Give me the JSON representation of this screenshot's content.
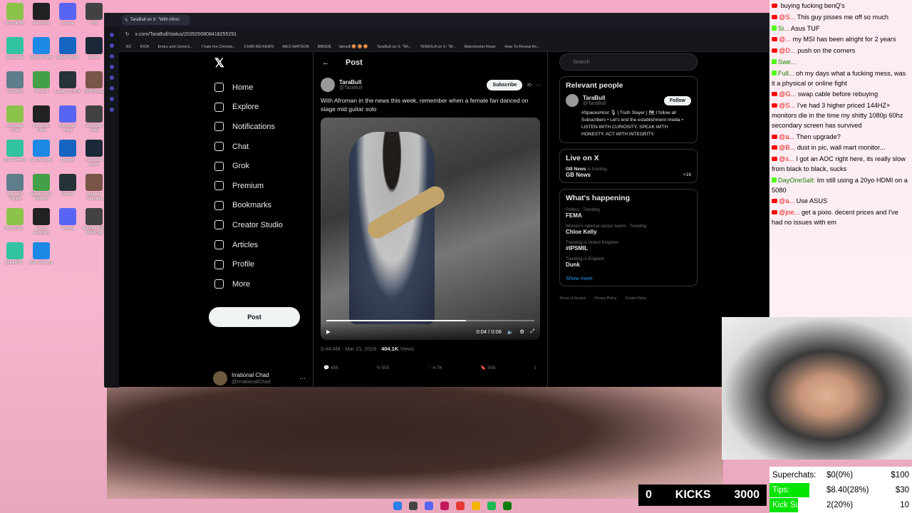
{
  "browser": {
    "tab_title": "TaraBull on X: \"With Afron",
    "url": "x.com/TaraBull/status/2035200808418255291",
    "bookmarks": [
      "BC",
      "KICK",
      "Emiru and Cinna's...",
      "I hate the Christia...",
      "CHIBI REVIEWS",
      "WES WATSON",
      "BBNO$",
      "bbno$ 🍪 🍪 🍪",
      "TaraBull on X: \"Wi...",
      "TENIOLA on X: \"M...",
      "Manchester Rose:",
      "How To Reveal An..."
    ]
  },
  "nav": {
    "items": [
      "Home",
      "Explore",
      "Notifications",
      "Chat",
      "Grok",
      "Premium",
      "Bookmarks",
      "Creator Studio",
      "Articles",
      "Profile",
      "More"
    ],
    "post_button": "Post",
    "account_name": "Irrational Chad",
    "account_handle": "@IrrationalChad"
  },
  "post": {
    "header": "Post",
    "author_name": "TaraBull",
    "author_handle": "@TaraBull",
    "subscribe": "Subscribe",
    "text": "With Afroman in the news this week, remember when a female fan danced on stage mid guitar solo",
    "video_time": "0:04 / 0:06",
    "video_progress": 0.67,
    "timestamp": "3:44 AM · Mar 21, 2026 ·",
    "views_count": "404.1K",
    "views_label": "Views",
    "replies": "456",
    "reposts": "505",
    "likes": "4.7K",
    "bookmarks": "558"
  },
  "sidebar": {
    "search_placeholder": "Search",
    "relevant_title": "Relevant people",
    "person_name": "TaraBull",
    "person_handle": "@TaraBull",
    "follow": "Follow",
    "bio": "#SpacesHost 🎙 | Truth Slayer | 🗺 I follow all Subscribers • Let's end the establishment media • LISTEN WITH CURIOSITY. SPEAK WITH HONESTY. ACT WITH INTEGRITY.",
    "live_title": "Live on X",
    "live_host": "GB News",
    "live_host_suffix": "is hosting",
    "live_name": "GB News",
    "live_count": "+16",
    "happening_title": "What's happening",
    "trends": [
      {
        "cat": "Politics · Trending",
        "name": "FEMA"
      },
      {
        "cat": "Women's national soccer teams · Trending",
        "name": "Chloe Kelly"
      },
      {
        "cat": "Trending in United Kingdom",
        "name": "#IPSMIL"
      },
      {
        "cat": "Trending in England",
        "name": "Dunk"
      }
    ],
    "show_more": "Show more",
    "footer": [
      "Terms of Service",
      "Privacy Policy",
      "Cookie Policy"
    ]
  },
  "chat": {
    "messages": [
      {
        "platform": "yt",
        "user": "",
        "text": "buying fucking benQ's"
      },
      {
        "platform": "yt",
        "user": "@S...",
        "text": "This guy pisses me off so much"
      },
      {
        "platform": "kick",
        "user": "Si...",
        "text": "Asus TUF"
      },
      {
        "platform": "yt",
        "user": "@...",
        "text": "my MSI has been alright for 2 years"
      },
      {
        "platform": "yt",
        "user": "@D...",
        "text": "push on the corners"
      },
      {
        "platform": "kick",
        "user": "Swe...",
        "text": ""
      },
      {
        "platform": "kick",
        "user": "Full...",
        "text": "oh my days what a fucking mess, was it a physical or online fight"
      },
      {
        "platform": "yt",
        "user": "@G...",
        "text": "swap cable before rebuying"
      },
      {
        "platform": "yt",
        "user": "@S...",
        "text": "I've had 3 higher priced 144HZ+ monitors die in the time my shitty 1080p 60hz secondary screen has survived"
      },
      {
        "platform": "yt",
        "user": "@a...",
        "text": "Then upgrade?"
      },
      {
        "platform": "yt",
        "user": "@B...",
        "text": "dust in pic, wall mart monitor..."
      },
      {
        "platform": "yt",
        "user": "@s...",
        "text": "I got an AOC right here, its really slow from black to black, sucks"
      },
      {
        "platform": "kick",
        "user": "DayOneSalt:",
        "text": "Im still using a 20yo HDMI on a 5080"
      },
      {
        "platform": "yt",
        "user": "@a...",
        "text": "Use ASUS"
      },
      {
        "platform": "yt",
        "user": "@joe...",
        "text": "get a pixio. decent prices and I've had no issues with em"
      }
    ]
  },
  "stats": {
    "superchats_label": "Superchats:",
    "superchats_value": "$0(0%)",
    "superchats_goal": "$100",
    "tips_label": "Tips:",
    "tips_value": "$8.40(28%)",
    "tips_goal": "$30",
    "tips_progress": 0.28,
    "kicksubs_label": "Kick Subs:",
    "kicksubs_value": "2(20%)",
    "kicksubs_goal": "10",
    "kicksubs_progress": 0.2
  },
  "kicks": {
    "current": "0",
    "label": "KICKS",
    "goal": "3000"
  },
  "desktop_icons": {
    "left": [
      "Recycle Bin",
      "obs-studio",
      "Discord",
      "OBS",
      "Streamlabs",
      "Roblox Player",
      "Roblox Studio",
      "Steam",
      "FAXSAVE",
      "Fallout 4",
      "Logitech G HUB",
      "EMOTE.png",
      "Sub badge 1.png",
      "Sub badge 2.png",
      "Sub badge 3.png",
      "Sub badge 4.png",
      "Chud Orff.png",
      "CL RAPE.png",
      "Stale.gif",
      "YLCmedia player",
      "Ppbnatch Test.jpg",
      "Resident Evil Requiem",
      "Fortnite",
      "Supreme Court.png",
      "Chud1619c...",
      "Todays mood.png",
      "Viper.gif",
      "IF ONLY YOU KNEW.jpg",
      "StreamEle...",
      "Dark Viper.png"
    ]
  }
}
